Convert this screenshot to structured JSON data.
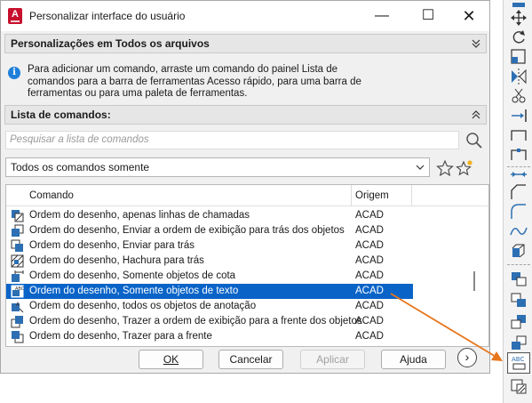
{
  "window": {
    "title": "Personalizar interface do usuário",
    "app_icon_letter": "A",
    "minimize_glyph": "—",
    "maximize_glyph": "☐",
    "close_glyph": "✕"
  },
  "customizations_section": {
    "title": "Personalizações em Todos os arquivos",
    "chevron": "⌄"
  },
  "info": {
    "text": "Para adicionar um comando, arraste um comando do painel Lista de comandos para a barra de ferramentas Acesso rápido, para uma barra de ferramentas ou para uma paleta de ferramentas."
  },
  "command_list_section": {
    "title": "Lista de comandos:",
    "chevron": "⌃"
  },
  "search": {
    "placeholder": "Pesquisar a lista de comandos"
  },
  "filter": {
    "selected": "Todos os comandos somente"
  },
  "table": {
    "columns": [
      "Comando",
      "Origem"
    ],
    "rows": [
      {
        "name": "Ordem do desenho, apenas linhas de chamadas",
        "origin": "ACAD",
        "selected": false
      },
      {
        "name": "Ordem do desenho, Enviar a ordem de exibição para trás dos objetos",
        "origin": "ACAD",
        "selected": false
      },
      {
        "name": "Ordem do desenho, Enviar para trás",
        "origin": "ACAD",
        "selected": false
      },
      {
        "name": "Ordem do desenho, Hachura para trás",
        "origin": "ACAD",
        "selected": false
      },
      {
        "name": "Ordem do desenho, Somente objetos de cota",
        "origin": "ACAD",
        "selected": false
      },
      {
        "name": "Ordem do desenho, Somente objetos de texto",
        "origin": "ACAD",
        "selected": true
      },
      {
        "name": "Ordem do desenho, todos os objetos de anotação",
        "origin": "ACAD",
        "selected": false
      },
      {
        "name": "Ordem do desenho, Trazer a ordem de exibição para a frente dos objetos",
        "origin": "ACAD",
        "selected": false
      },
      {
        "name": "Ordem do desenho, Trazer para a frente",
        "origin": "ACAD",
        "selected": false
      }
    ]
  },
  "buttons": {
    "ok": "OK",
    "cancel": "Cancelar",
    "apply": "Aplicar",
    "help": "Ajuda",
    "more_glyph": "›"
  },
  "palette": {
    "tools": [
      "move-icon",
      "rotate-icon",
      "scale-icon",
      "mirror-icon",
      "trim-icon",
      "extend-icon",
      "break-icon",
      "join-icon",
      "chamfer-icon",
      "fillet-icon",
      "spline-icon",
      "3d-box-icon",
      "bring-to-front-icon",
      "send-to-back-icon",
      "bring-above-icon",
      "send-under-icon",
      "text-to-front-icon",
      "hatch-to-back-icon"
    ],
    "text_tool_label": "ABC"
  },
  "colors": {
    "accent": "#0a64c8",
    "arrow": "#e8761c",
    "app_icon": "#c8102e"
  }
}
